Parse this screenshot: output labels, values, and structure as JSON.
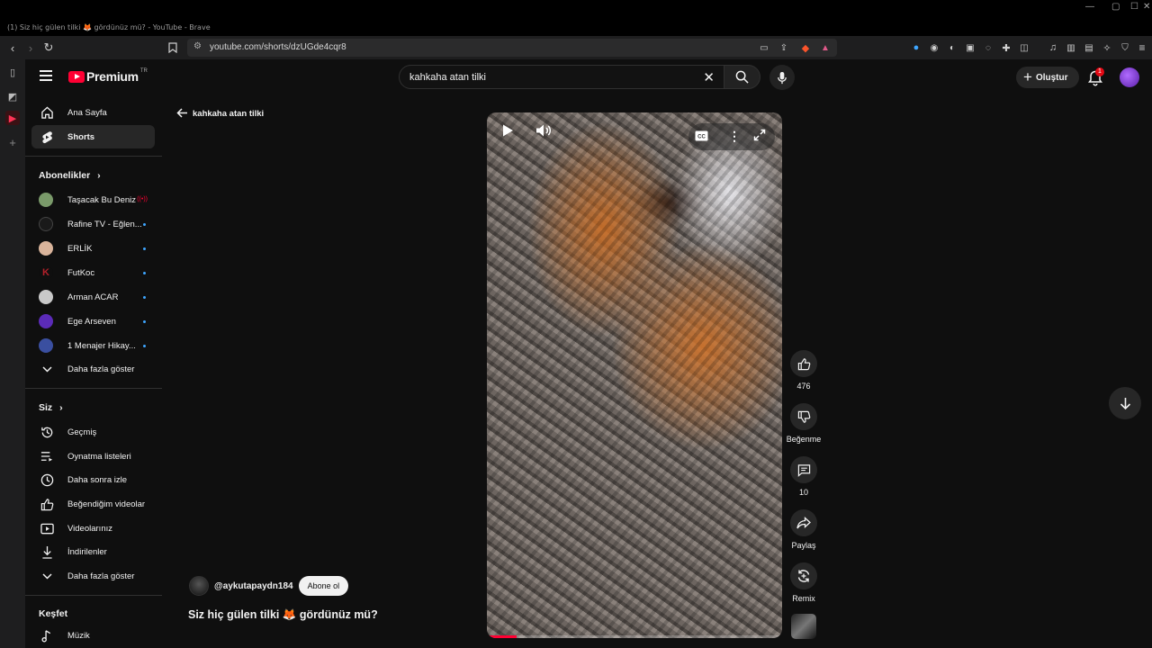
{
  "window": {
    "title": "(1) Siz hiç gülen tilki 🦊 gördünüz mü? - YouTube - Brave"
  },
  "browser": {
    "url": "youtube.com/shorts/dzUGde4cqr8"
  },
  "header": {
    "logo_text": "Premium",
    "logo_superscript": "TR",
    "search_query": "kahkaha atan tilki",
    "create_label": "Oluştur",
    "notification_count": "1"
  },
  "sidebar": {
    "main": [
      {
        "label": "Ana Sayfa",
        "icon": "home-icon"
      },
      {
        "label": "Shorts",
        "icon": "shorts-icon",
        "active": true
      }
    ],
    "subscriptions_title": "Abonelikler",
    "subscriptions": [
      {
        "label": "Taşacak Bu Deniz",
        "color": "#7a9a6a",
        "live": true
      },
      {
        "label": "Rafine TV - Eğlen...",
        "color": "#cfcfcf"
      },
      {
        "label": "ERLİK",
        "color": "#d9b49b"
      },
      {
        "label": "FutKoc",
        "color": "#b3202a"
      },
      {
        "label": "Arman ACAR",
        "color": "#c9c9c9"
      },
      {
        "label": "Ege Arseven",
        "color": "#5b2bb8"
      },
      {
        "label": "1 Menajer Hikay...",
        "color": "#3a4fa0"
      }
    ],
    "subs_more": "Daha fazla göster",
    "you_title": "Siz",
    "you": [
      {
        "label": "Geçmiş",
        "icon": "history-icon"
      },
      {
        "label": "Oynatma listeleri",
        "icon": "playlists-icon"
      },
      {
        "label": "Daha sonra izle",
        "icon": "watch-later-icon"
      },
      {
        "label": "Beğendiğim videolar",
        "icon": "liked-videos-icon"
      },
      {
        "label": "Videolarınız",
        "icon": "your-videos-icon"
      },
      {
        "label": "İndirilenler",
        "icon": "downloads-icon"
      }
    ],
    "you_more": "Daha fazla göster",
    "explore_title": "Keşfet",
    "explore": [
      {
        "label": "Müzik",
        "icon": "music-icon"
      }
    ]
  },
  "main": {
    "back_label": "kahkaha atan tilki",
    "channel_name": "@aykutapaydn184",
    "subscribe_label": "Abone ol",
    "video_title": "Siz hiç gülen tilki 🦊 gördünüz mü?",
    "progress": 0.1,
    "actions": {
      "like_count": "476",
      "dislike_label": "Beğenme",
      "comment_count": "10",
      "share_label": "Paylaş",
      "remix_label": "Remix"
    }
  },
  "colors": {
    "accent": "#ff0033",
    "background": "#0f0f0f",
    "surface": "#272727"
  }
}
